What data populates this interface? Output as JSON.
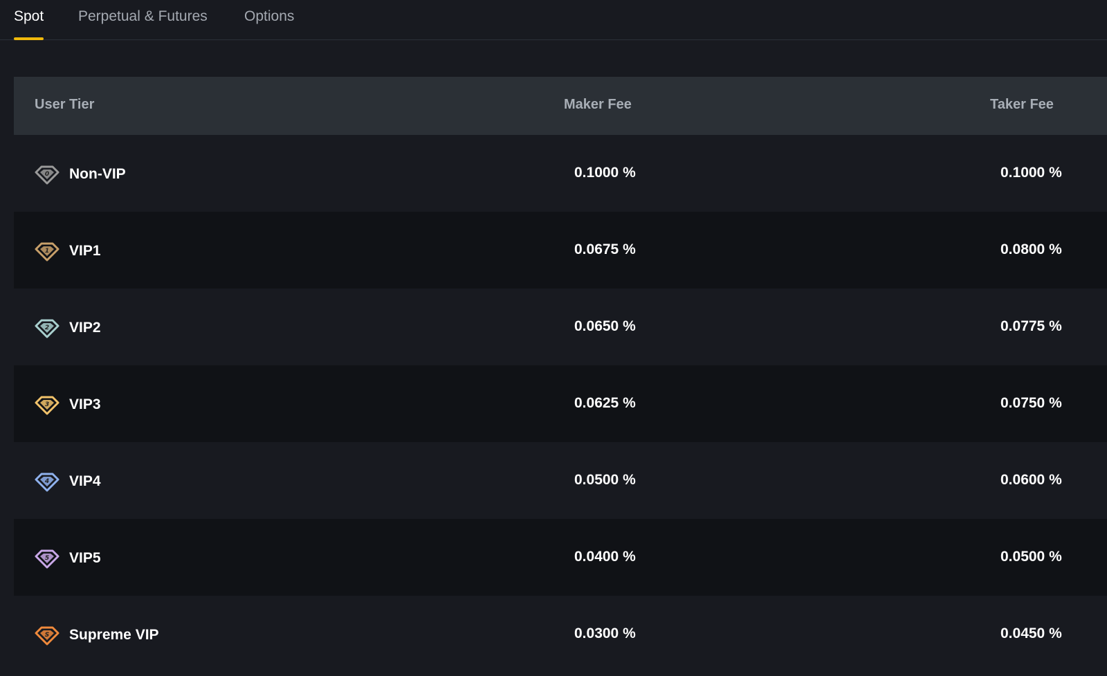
{
  "tabs": [
    {
      "label": "Spot",
      "active": true
    },
    {
      "label": "Perpetual & Futures",
      "active": false
    },
    {
      "label": "Options",
      "active": false
    }
  ],
  "colors": {
    "accent": "#f0b90b",
    "background": "#181a20",
    "header": "#2b3036"
  },
  "table": {
    "headers": {
      "tier": "User Tier",
      "maker": "Maker Fee",
      "taker": "Taker Fee"
    },
    "rows": [
      {
        "level": "0",
        "tier": "Non-VIP",
        "maker": "0.1000 %",
        "taker": "0.1000 %",
        "icon": "vip-0-badge-icon",
        "color": "#9a9a9a"
      },
      {
        "level": "1",
        "tier": "VIP1",
        "maker": "0.0675 %",
        "taker": "0.0800 %",
        "icon": "vip-1-badge-icon",
        "color": "#c8a06a"
      },
      {
        "level": "2",
        "tier": "VIP2",
        "maker": "0.0650 %",
        "taker": "0.0775 %",
        "icon": "vip-2-badge-icon",
        "color": "#a9d0cf"
      },
      {
        "level": "3",
        "tier": "VIP3",
        "maker": "0.0625 %",
        "taker": "0.0750 %",
        "icon": "vip-3-badge-icon",
        "color": "#f2c36b"
      },
      {
        "level": "4",
        "tier": "VIP4",
        "maker": "0.0500 %",
        "taker": "0.0600 %",
        "icon": "vip-4-badge-icon",
        "color": "#8fb2ee"
      },
      {
        "level": "5",
        "tier": "VIP5",
        "maker": "0.0400 %",
        "taker": "0.0500 %",
        "icon": "vip-5-badge-icon",
        "color": "#c9a8e8"
      },
      {
        "level": "S",
        "tier": "Supreme VIP",
        "maker": "0.0300 %",
        "taker": "0.0450 %",
        "icon": "supreme-vip-badge-icon",
        "color": "#f08a3c"
      }
    ]
  }
}
